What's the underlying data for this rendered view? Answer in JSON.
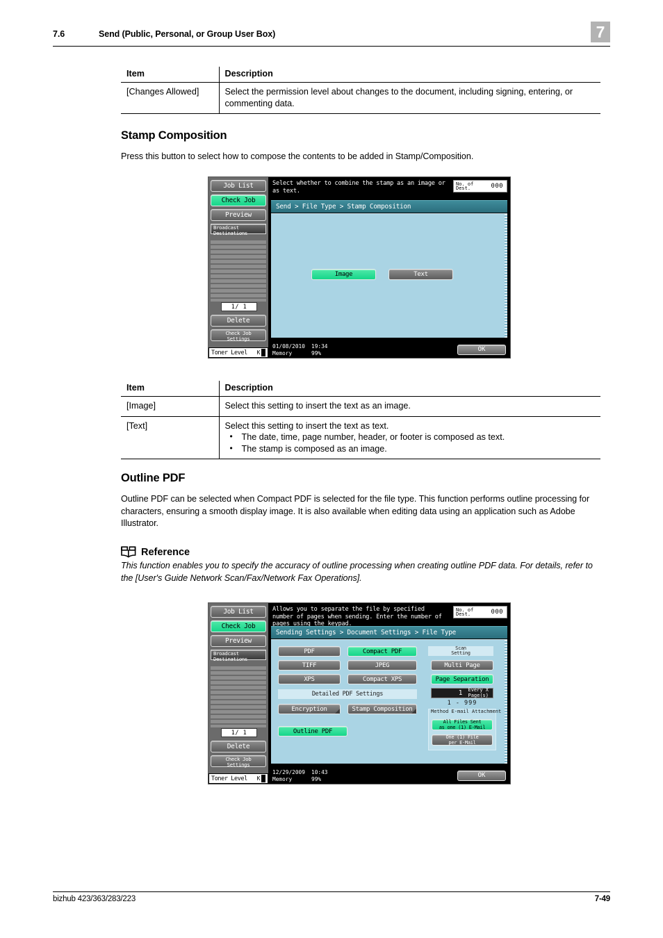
{
  "header": {
    "section_number": "7.6",
    "section_title": "Send (Public, Personal, or Group User Box)",
    "chapter": "7"
  },
  "table1": {
    "headers": [
      "Item",
      "Description"
    ],
    "rows": [
      {
        "item": "[Changes Allowed]",
        "description": "Select the permission level about changes to the document, including signing, entering, or commenting data."
      }
    ]
  },
  "stamp_section": {
    "title": "Stamp Composition",
    "paragraph": "Press this button to select how to compose the contents to be added in Stamp/Composition."
  },
  "panel1": {
    "sidebar": {
      "job_list": "Job List",
      "check_job": "Check Job",
      "preview": "Preview",
      "broadcast_line1": "Broadcast",
      "broadcast_line2": "Destinations",
      "page_indicator": "1/  1",
      "delete": "Delete",
      "check_job_settings_line1": "Check Job",
      "check_job_settings_line2": "Settings",
      "toner_label": "Toner Level",
      "toner_color": "K"
    },
    "message": "Select whether to combine the stamp as an image or as text.",
    "dest_label_line1": "No. of",
    "dest_label_line2": "Dest.",
    "dest_value": "000",
    "breadcrumb": "Send > File Type > Stamp Composition",
    "buttons": [
      {
        "label": "Image",
        "selected": true
      },
      {
        "label": "Text",
        "selected": false
      }
    ],
    "status": {
      "date": "01/08/2010",
      "time": "19:34",
      "memory_label": "Memory",
      "memory_value": "99%"
    },
    "ok_label": "OK"
  },
  "table2": {
    "headers": [
      "Item",
      "Description"
    ],
    "rows": [
      {
        "item": "[Image]",
        "description": "Select this setting to insert the text as an image.",
        "bullets": []
      },
      {
        "item": "[Text]",
        "description": "Select this setting to insert the text as text.",
        "bullets": [
          "The date, time, page number, header, or footer is composed as text.",
          "The stamp is composed as an image."
        ]
      }
    ]
  },
  "outline_section": {
    "title": "Outline PDF",
    "paragraph": "Outline PDF can be selected when Compact PDF is selected for the file type. This function performs outline processing for characters, ensuring a smooth display image. It is also available when editing data using an application such as Adobe Illustrator.",
    "reference_label": "Reference",
    "reference_text": "This function enables you to specify the accuracy of outline processing when creating outline PDF data. For details, refer to the [User's Guide Network Scan/Fax/Network Fax Operations]."
  },
  "panel2": {
    "sidebar": {
      "job_list": "Job List",
      "check_job": "Check Job",
      "preview": "Preview",
      "broadcast_line1": "Broadcast",
      "broadcast_line2": "Destinations",
      "page_indicator": "1/  1",
      "delete": "Delete",
      "check_job_settings_line1": "Check Job",
      "check_job_settings_line2": "Settings",
      "toner_label": "Toner Level",
      "toner_color": "K"
    },
    "message": "Allows you to separate the file by specified number of pages when sending. Enter the number of pages using the keypad.",
    "dest_label_line1": "No. of",
    "dest_label_line2": "Dest.",
    "dest_value": "000",
    "breadcrumb": "Sending Settings > Document Settings > File Type",
    "filetype_buttons": [
      {
        "label": "PDF",
        "selected": false
      },
      {
        "label": "Compact PDF",
        "selected": true
      },
      {
        "label": "TIFF",
        "selected": false
      },
      {
        "label": "JPEG",
        "selected": false
      },
      {
        "label": "XPS",
        "selected": false
      },
      {
        "label": "Compact XPS",
        "selected": false
      }
    ],
    "detailed_label": "Detailed PDF Settings",
    "detail_buttons": [
      {
        "label": "Encryption",
        "selected": false
      },
      {
        "label": "Stamp Composition",
        "selected": false
      }
    ],
    "outline_button": {
      "label": "Outline PDF",
      "selected": true
    },
    "scan_setting_line1": "Scan",
    "scan_setting_line2": "Setting",
    "multi_page": {
      "label": "Multi Page",
      "selected": false
    },
    "page_separation": {
      "label": "Page Separation",
      "selected": true
    },
    "page_count_value": "1",
    "page_count_label_line1": "Every X",
    "page_count_label_line2": "Page(s)",
    "page_count_range": "1  -  999",
    "email_group_line1": "E-mail Attachment",
    "email_group_line2": "Method",
    "email_buttons": [
      {
        "label_line1": "All Files Sent",
        "label_line2": "as one (1) E-Mail",
        "selected": true
      },
      {
        "label_line1": "One (1) File",
        "label_line2": "per E-Mail",
        "selected": false
      }
    ],
    "status": {
      "date": "12/29/2009",
      "time": "10:43",
      "memory_label": "Memory",
      "memory_value": "99%"
    },
    "ok_label": "OK"
  },
  "footer": {
    "product": "bizhub 423/363/283/223",
    "page": "7-49"
  }
}
